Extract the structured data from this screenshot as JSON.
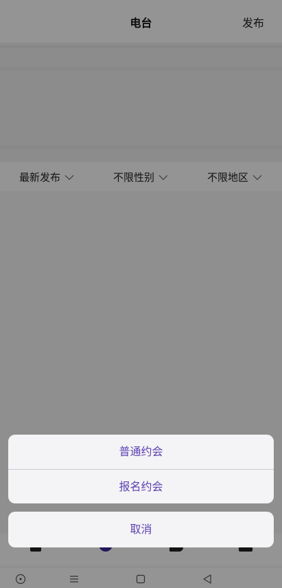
{
  "header": {
    "title": "电台",
    "publish_label": "发布"
  },
  "filters": [
    {
      "label": "最新发布"
    },
    {
      "label": "不限性别"
    },
    {
      "label": "不限地区"
    }
  ],
  "action_sheet": {
    "options": [
      {
        "label": "普通约会"
      },
      {
        "label": "报名约会"
      }
    ],
    "cancel_label": "取消"
  },
  "colors": {
    "accent": "#5b3fb0",
    "overlay": "rgba(0,0,0,0.42)",
    "sheet_bg": "#f4f4f6"
  },
  "icons": {
    "filter_chevron": "chevron-down-icon",
    "system_nav": [
      "recent-apps-icon",
      "menu-icon",
      "home-square-icon",
      "back-triangle-icon"
    ]
  }
}
